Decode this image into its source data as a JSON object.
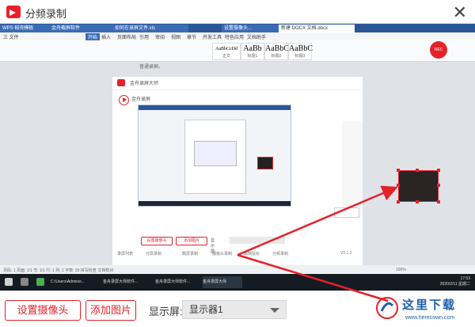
{
  "window": {
    "title": "分频录制",
    "close_label": "✕"
  },
  "preview": {
    "wps_tabs": [
      "WPS 稻壳模板",
      "金舟截屏软件",
      "如何在录屏文件.xls",
      "设置摄像头...",
      "新建 DOCX 文档.docx"
    ],
    "ribbon_menu": [
      "三 文件",
      "开始",
      "插入",
      "页面布局",
      "引用",
      "审阅",
      "视图",
      "章节",
      "开发工具",
      "特色应用",
      "文档助手"
    ],
    "style_boxes": [
      {
        "sample": "AaBbCcDd",
        "caption": "正文"
      },
      {
        "sample": "AaBb",
        "caption": "标题1"
      },
      {
        "sample": "AaBbC",
        "caption": "标题2"
      },
      {
        "sample": "AaBbC",
        "caption": "标题3"
      }
    ],
    "record_badge": "REC",
    "doc_text": "普通录屏。",
    "nested": {
      "title": "金舟录屏大师",
      "sub_title": "金舟录屏",
      "buttons": [
        "设置摄像头",
        "添加图片"
      ],
      "display_label": "显示屏:",
      "footer": [
        "录屏列表",
        "分屏录制",
        "截屏录制",
        "摄像头录制",
        "跟随鼠标",
        "分频录制"
      ],
      "version": "V2.1.2"
    },
    "status_bar": "页码: 1  页面: 1/1  节: 1/1  行: 1  列: 1  字数: 29  拼写检查  文档校对",
    "zoom": "100%",
    "taskbar": {
      "items": [
        "C:\\Users\\Adminis...",
        "金舟录屏大师软件...",
        "金舟录屏大师软件...",
        "金舟录屏大师"
      ],
      "time": "17:53",
      "date": "2020/2/11 星期二"
    }
  },
  "controls": {
    "set_camera": "设置摄像头",
    "add_image": "添加图片",
    "display_label": "显示屏:",
    "display_value": "显示器1"
  },
  "watermark": {
    "text": "这里下载",
    "url": "www.herecown.com"
  },
  "colors": {
    "accent": "#e6212a",
    "watermark": "#1e5fa8"
  }
}
